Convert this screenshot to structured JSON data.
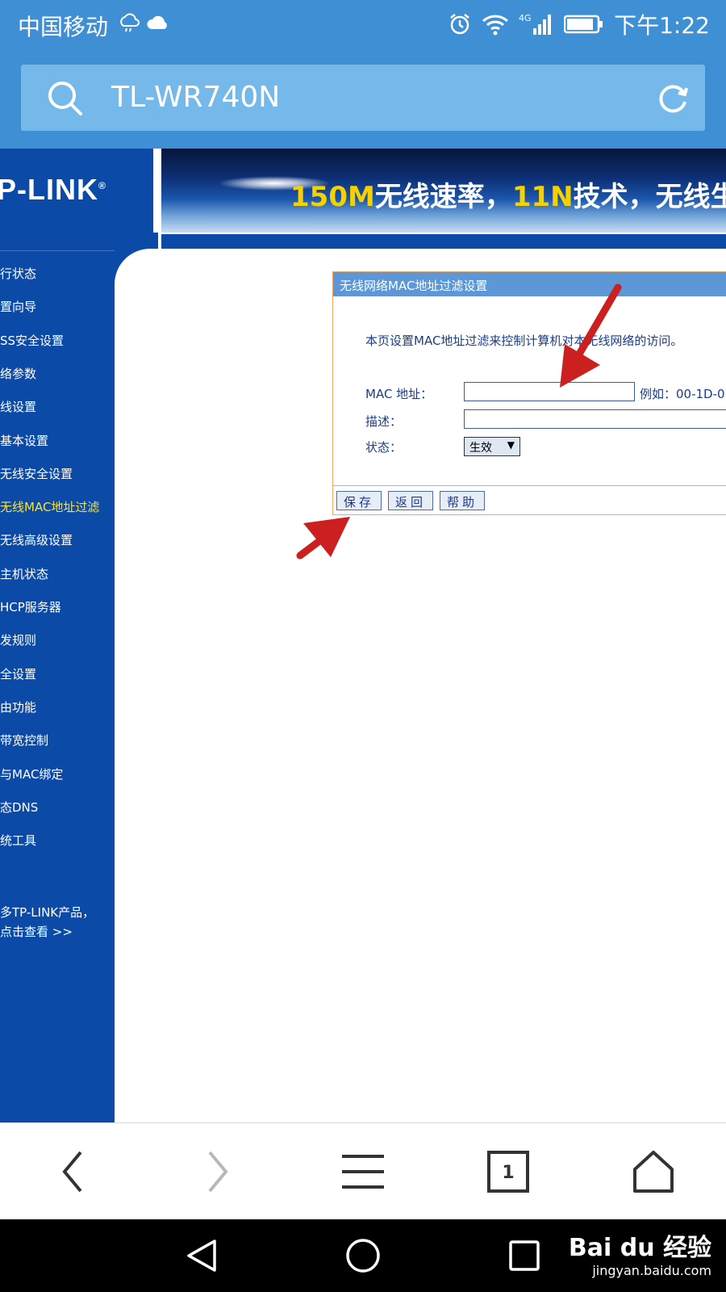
{
  "status_bar": {
    "carrier": "中国移动",
    "network_label": "4G",
    "time": "下午1:22"
  },
  "browser": {
    "url": "TL-WR740N",
    "tab_count": "1"
  },
  "router": {
    "logo": "P-LINK",
    "banner": {
      "part1": "150M",
      "part2": "无线速率，",
      "part3": "11N",
      "part4": "技术，无线生"
    },
    "nav_items": [
      {
        "label": "行状态"
      },
      {
        "label": "置向导"
      },
      {
        "label": "SS安全设置"
      },
      {
        "label": "络参数"
      },
      {
        "label": "线设置"
      },
      {
        "label": "基本设置"
      },
      {
        "label": "无线安全设置"
      },
      {
        "label": "无线MAC地址过滤",
        "active": true
      },
      {
        "label": "无线高级设置"
      },
      {
        "label": "主机状态"
      },
      {
        "label": "HCP服务器"
      },
      {
        "label": "发规则"
      },
      {
        "label": "全设置"
      },
      {
        "label": "由功能"
      },
      {
        "label": "带宽控制"
      },
      {
        "label": "与MAC绑定"
      },
      {
        "label": "态DNS"
      },
      {
        "label": "统工具"
      }
    ],
    "more_products": {
      "line1": "多TP-LINK产品，",
      "line2": "点击查看 >>"
    },
    "form": {
      "title": "无线网络MAC地址过滤设置",
      "description": "本页设置MAC地址过滤来控制计算机对本无线网络的访问。",
      "mac_label": "MAC 地址：",
      "mac_value": "",
      "mac_example": "例如：00-1D-0",
      "desc_label": "描述：",
      "desc_value": "",
      "status_label": "状态：",
      "status_value": "生效",
      "buttons": {
        "save": "保存",
        "back": "返回",
        "help": "帮助"
      }
    }
  },
  "watermark": {
    "brand": "Bai du 经验",
    "site": "jingyan.baidu.com"
  },
  "colors": {
    "browser_blue": "#3f8fd5",
    "url_box": "#74b9ea",
    "router_blue": "#0b4aa6",
    "active_nav": "#f5e24a",
    "panel_header": "#5d97d8",
    "panel_border": "#f0a760",
    "arrow_red": "#cc2020"
  }
}
